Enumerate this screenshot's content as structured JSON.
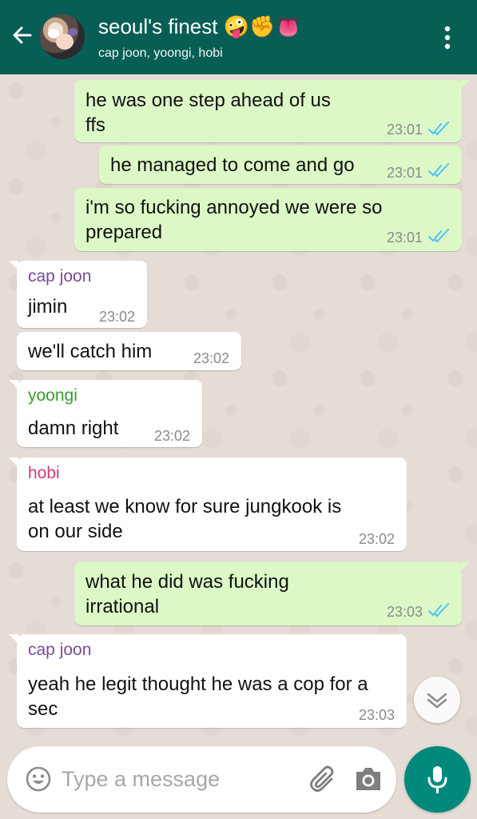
{
  "header": {
    "title": "seoul's finest 🤪✊👅",
    "subtitle": "cap joon, yoongi, hobi"
  },
  "messages": [
    {
      "direction": "out",
      "lines": [
        "he was one step ahead of us",
        "ffs"
      ],
      "time": "23:01",
      "status": "read"
    },
    {
      "direction": "out",
      "lines": [
        "he managed to come and go"
      ],
      "time": "23:01",
      "status": "read"
    },
    {
      "direction": "out",
      "lines": [
        "i'm so fucking annoyed we were so",
        "prepared"
      ],
      "time": "23:01",
      "status": "read"
    },
    {
      "direction": "in",
      "sender": "cap joon",
      "lines": [
        "jimin"
      ],
      "time": "23:02"
    },
    {
      "direction": "in",
      "lines": [
        "we'll catch him"
      ],
      "time": "23:02"
    },
    {
      "direction": "in",
      "sender": "yoongi",
      "lines": [
        "damn right"
      ],
      "time": "23:02"
    },
    {
      "direction": "in",
      "sender": "hobi",
      "lines": [
        "at least we know for sure jungkook is",
        "on our side"
      ],
      "time": "23:02"
    },
    {
      "direction": "out",
      "lines": [
        "what he did was fucking",
        "irrational"
      ],
      "time": "23:03",
      "status": "read"
    },
    {
      "direction": "in",
      "sender": "cap joon",
      "lines": [
        "yeah he legit thought he was a cop for a",
        "sec"
      ],
      "time": "23:03"
    }
  ],
  "senders": {
    "cap joon": "#7b4b94",
    "yoongi": "#3a9b2f",
    "hobi": "#d33a74"
  },
  "composer": {
    "placeholder": "Type a message",
    "value": ""
  },
  "icons": {
    "back": "arrow-left-icon",
    "menu": "more-vertical-icon",
    "emoji": "smiley-icon",
    "attach": "paperclip-icon",
    "camera": "camera-icon",
    "mic": "microphone-icon",
    "scroll": "chevron-down-icon"
  },
  "colors": {
    "header": "#075e54",
    "outgoing_bubble": "#dcf8c6",
    "incoming_bubble": "#ffffff",
    "read_ticks": "#4fc3f7",
    "mic_button": "#00897b"
  }
}
